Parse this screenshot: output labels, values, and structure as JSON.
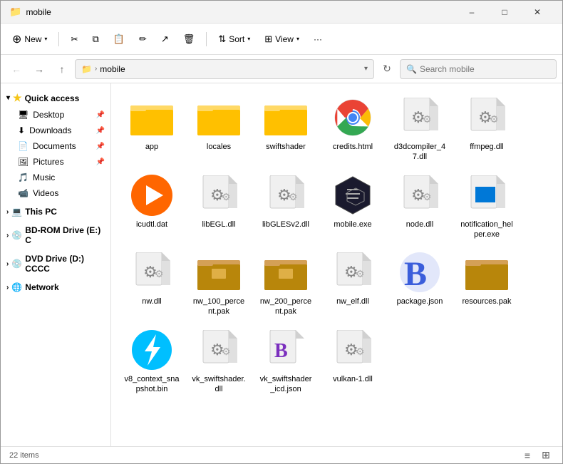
{
  "window": {
    "title": "mobile",
    "titlebar_icon": "📁"
  },
  "toolbar": {
    "new_label": "New",
    "cut_label": "✂",
    "copy_label": "⧉",
    "paste_label": "⧉",
    "rename_label": "✏",
    "share_label": "↗",
    "delete_label": "🗑",
    "sort_label": "Sort",
    "view_label": "View",
    "more_label": "···"
  },
  "navbar": {
    "address_folder": "mobile",
    "search_placeholder": "Search mobile"
  },
  "sidebar": {
    "quick_access_label": "Quick access",
    "items": [
      {
        "label": "Desktop",
        "icon": "desktop",
        "pin": true
      },
      {
        "label": "Downloads",
        "icon": "downloads",
        "pin": true
      },
      {
        "label": "Documents",
        "icon": "documents",
        "pin": true
      },
      {
        "label": "Pictures",
        "icon": "pictures",
        "pin": true
      },
      {
        "label": "Music",
        "icon": "music",
        "pin": false
      },
      {
        "label": "Videos",
        "icon": "videos",
        "pin": false
      }
    ],
    "this_pc_label": "This PC",
    "bdrom_label": "BD-ROM Drive (E:) C",
    "dvd_label": "DVD Drive (D:) CCCC",
    "network_label": "Network"
  },
  "files": [
    {
      "name": "app",
      "type": "folder"
    },
    {
      "name": "locales",
      "type": "folder"
    },
    {
      "name": "swiftshader",
      "type": "folder"
    },
    {
      "name": "credits.html",
      "type": "chrome"
    },
    {
      "name": "d3dcompiler_47.dll",
      "type": "gear-doc"
    },
    {
      "name": "ffmpeg.dll",
      "type": "gear-doc"
    },
    {
      "name": "icudtl.dat",
      "type": "media-play"
    },
    {
      "name": "libEGL.dll",
      "type": "gear-doc"
    },
    {
      "name": "libGLESv2.dll",
      "type": "gear-doc"
    },
    {
      "name": "mobile.exe",
      "type": "dark-hex"
    },
    {
      "name": "node.dll",
      "type": "gear-doc"
    },
    {
      "name": "notification_helper.exe",
      "type": "blue-doc"
    },
    {
      "name": "nw.dll",
      "type": "gear-doc"
    },
    {
      "name": "nw_100_percent.pak",
      "type": "pak-folder"
    },
    {
      "name": "nw_200_percent.pak",
      "type": "pak-folder"
    },
    {
      "name": "nw_elf.dll",
      "type": "gear-doc"
    },
    {
      "name": "package.json",
      "type": "bbcode-b"
    },
    {
      "name": "resources.pak",
      "type": "pak-folder2"
    },
    {
      "name": "v8_context_snapshot.bin",
      "type": "blue-lightning"
    },
    {
      "name": "vk_swiftshader.dll",
      "type": "gear-doc"
    },
    {
      "name": "vk_swiftshader_icd.json",
      "type": "purple-b"
    },
    {
      "name": "vulkan-1.dll",
      "type": "gear-doc"
    }
  ],
  "statusbar": {
    "count_label": "22 items"
  }
}
